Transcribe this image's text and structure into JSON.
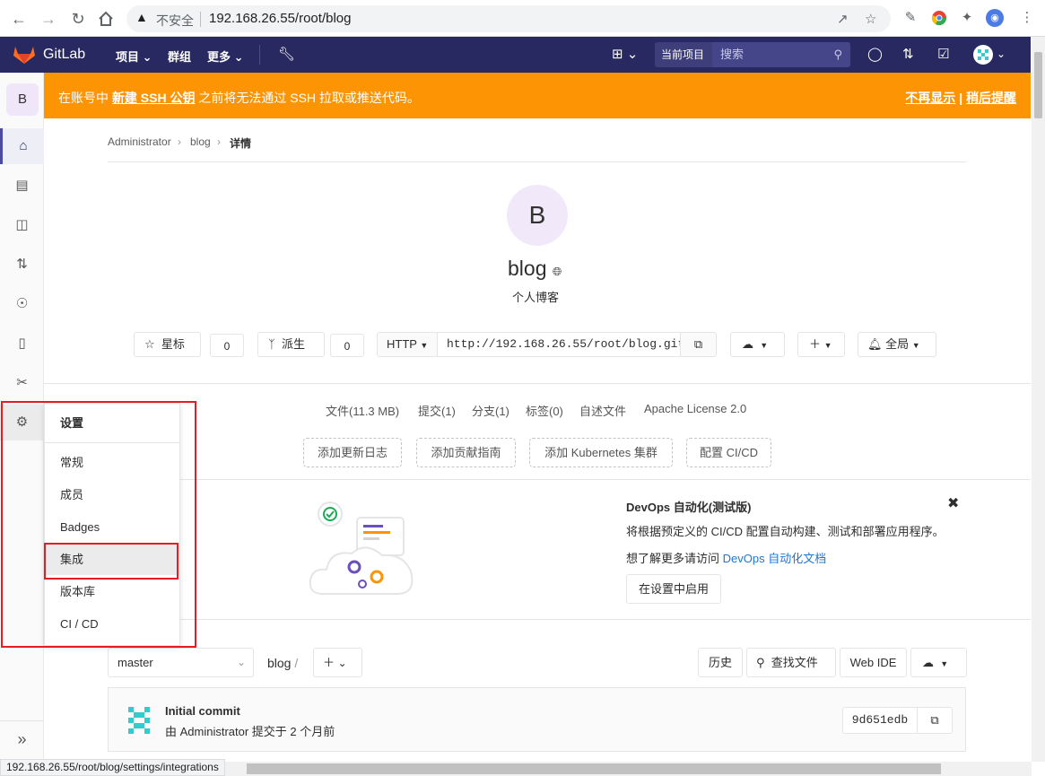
{
  "browser": {
    "insecure_label": "不安全",
    "url": "192.168.26.55/root/blog",
    "status_url": "192.168.26.55/root/blog/settings/integrations"
  },
  "header": {
    "brand": "GitLab",
    "nav": [
      "项目",
      "群组",
      "更多"
    ],
    "scope": "当前项目",
    "search_placeholder": "搜索"
  },
  "sidebar": {
    "avatar_letter": "B"
  },
  "banner": {
    "prefix": "在账号中",
    "link": "新建 SSH 公钥",
    "suffix": "之前将无法通过 SSH 拉取或推送代码。",
    "dont_show": "不再显示",
    "separator": "|",
    "remind_later": "稍后提醒"
  },
  "breadcrumb": [
    "Administrator",
    "blog",
    "详情"
  ],
  "project": {
    "avatar_letter": "B",
    "name": "blog",
    "description": "个人博客",
    "star_label": "星标",
    "star_count": "0",
    "fork_label": "派生",
    "fork_count": "0",
    "protocol": "HTTP",
    "clone_url": "http://192.168.26.55/root/blog.git",
    "notification": "全局"
  },
  "stats": [
    "文件(11.3 MB)",
    "提交(1)",
    "分支(1)",
    "标签(0)",
    "自述文件",
    "Apache License 2.0"
  ],
  "quick_actions": [
    "添加更新日志",
    "添加贡献指南",
    "添加 Kubernetes 集群",
    "配置 CI/CD"
  ],
  "devops": {
    "title": "DevOps 自动化(测试版)",
    "text": "将根据预定义的 CI/CD 配置自动构建、测试和部署应用程序。",
    "more_prefix": "想了解更多请访问",
    "more_link": "DevOps 自动化文档",
    "enable_button": "在设置中启用"
  },
  "settings_menu": {
    "title": "设置",
    "items": [
      "常规",
      "成员",
      "Badges",
      "集成",
      "版本库",
      "CI / CD"
    ]
  },
  "repo": {
    "branch": "master",
    "path": "blog",
    "path_sep": "/",
    "history": "历史",
    "find_file": "查找文件",
    "web_ide": "Web IDE"
  },
  "commit": {
    "title": "Initial commit",
    "meta": "由 Administrator 提交于 2 个月前",
    "sha": "9d651edb"
  }
}
